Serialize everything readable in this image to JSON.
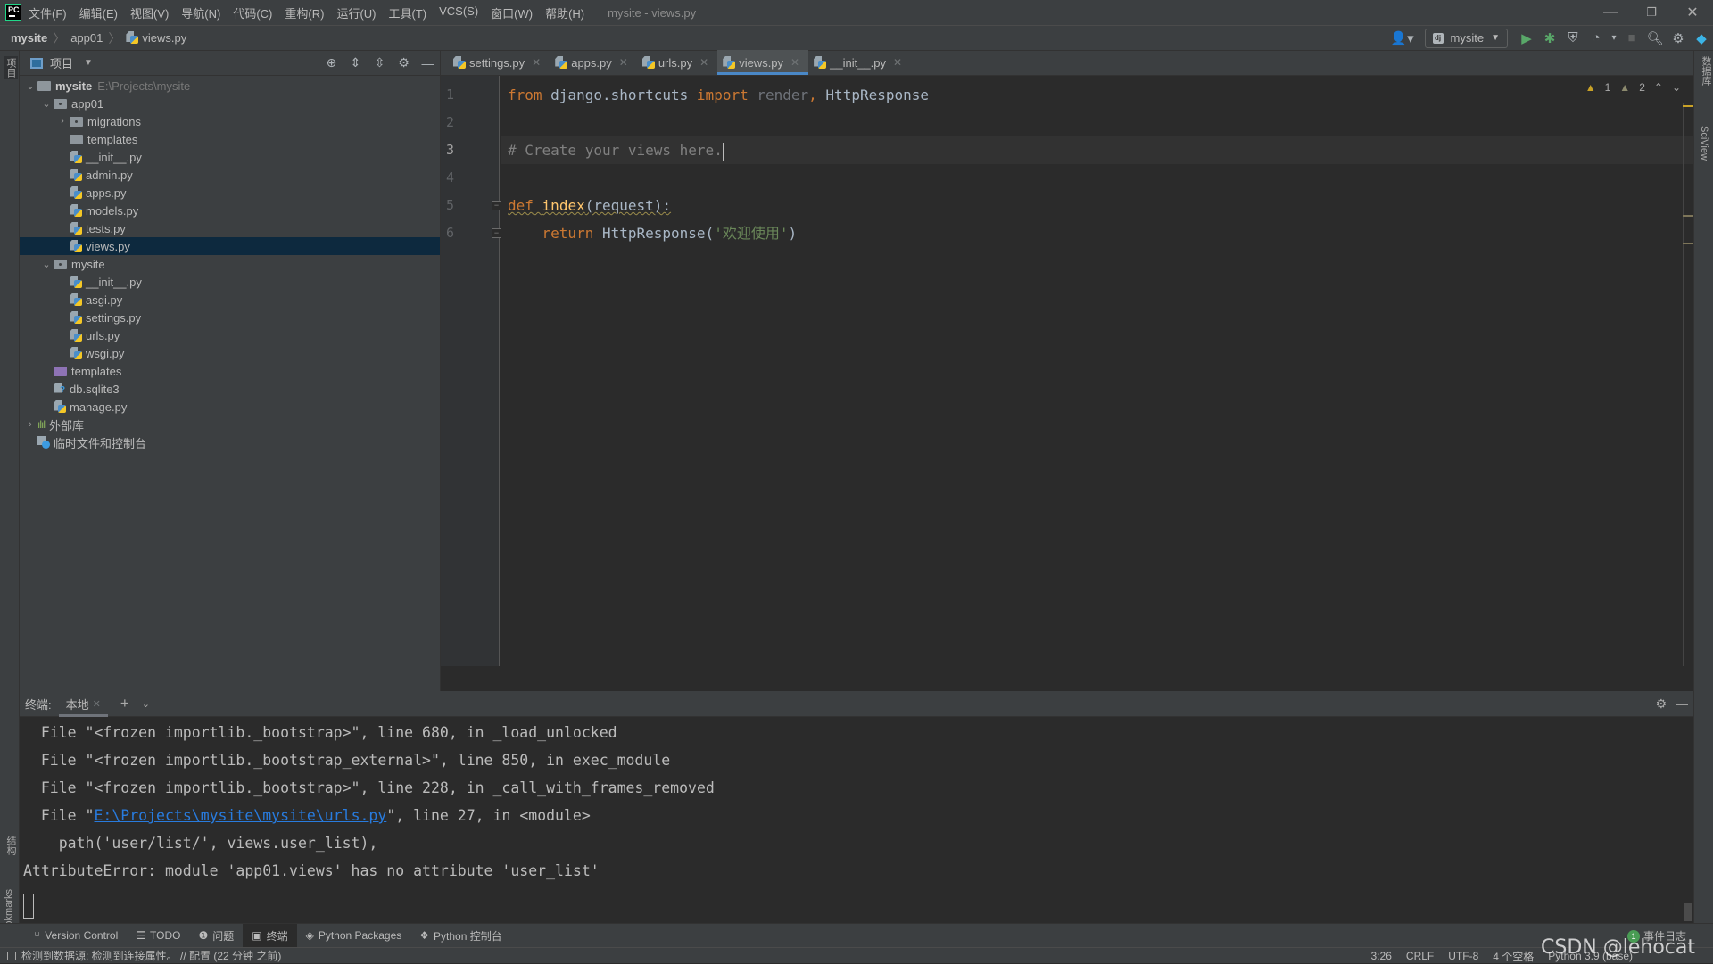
{
  "window": {
    "title": "mysite - views.py",
    "logo": "PC",
    "menu": [
      "文件(F)",
      "编辑(E)",
      "视图(V)",
      "导航(N)",
      "代码(C)",
      "重构(R)",
      "运行(U)",
      "工具(T)",
      "VCS(S)",
      "窗口(W)",
      "帮助(H)"
    ],
    "controls": {
      "minimize": "—",
      "restore": "❐",
      "close": "✕"
    }
  },
  "navbar": {
    "breadcrumb": [
      "mysite",
      "app01",
      "views.py"
    ],
    "run_config": "mysite",
    "run_config_icon": "dj"
  },
  "left_stripe": {
    "project_label": "项目",
    "structure_label": "结构",
    "bookmarks_label": "Bookmarks"
  },
  "right_stripe": {
    "database_label": "数据库",
    "sciview_label": "SciView"
  },
  "project_panel": {
    "title": "项目",
    "tree": [
      {
        "label": "mysite",
        "hint": "E:\\Projects\\mysite",
        "level": 0,
        "type": "folder",
        "expanded": true,
        "bold": true
      },
      {
        "label": "app01",
        "level": 1,
        "type": "module",
        "expanded": true
      },
      {
        "label": "migrations",
        "level": 2,
        "type": "module",
        "expanded": false
      },
      {
        "label": "templates",
        "level": 2,
        "type": "folder"
      },
      {
        "label": "__init__.py",
        "level": 2,
        "type": "py"
      },
      {
        "label": "admin.py",
        "level": 2,
        "type": "py"
      },
      {
        "label": "apps.py",
        "level": 2,
        "type": "py"
      },
      {
        "label": "models.py",
        "level": 2,
        "type": "py"
      },
      {
        "label": "tests.py",
        "level": 2,
        "type": "py"
      },
      {
        "label": "views.py",
        "level": 2,
        "type": "py",
        "selected": true
      },
      {
        "label": "mysite",
        "level": 1,
        "type": "module",
        "expanded": true
      },
      {
        "label": "__init__.py",
        "level": 2,
        "type": "py"
      },
      {
        "label": "asgi.py",
        "level": 2,
        "type": "py"
      },
      {
        "label": "settings.py",
        "level": 2,
        "type": "py"
      },
      {
        "label": "urls.py",
        "level": 2,
        "type": "py"
      },
      {
        "label": "wsgi.py",
        "level": 2,
        "type": "py"
      },
      {
        "label": "templates",
        "level": 1,
        "type": "purple"
      },
      {
        "label": "db.sqlite3",
        "level": 1,
        "type": "db"
      },
      {
        "label": "manage.py",
        "level": 1,
        "type": "py"
      },
      {
        "label": "外部库",
        "level": 0,
        "type": "lib",
        "expanded": false
      },
      {
        "label": "临时文件和控制台",
        "level": 0,
        "type": "scratch"
      }
    ]
  },
  "editor": {
    "tabs": [
      {
        "label": "settings.py",
        "active": false
      },
      {
        "label": "apps.py",
        "active": false
      },
      {
        "label": "urls.py",
        "active": false
      },
      {
        "label": "views.py",
        "active": true
      },
      {
        "label": "__init__.py",
        "active": false
      }
    ],
    "inspections": {
      "warnings": "1",
      "weak_warnings": "2"
    },
    "current_line": 3,
    "lines": [
      {
        "num": "1",
        "tokens": [
          {
            "t": "from",
            "c": "kw"
          },
          {
            "t": " django.shortcuts ",
            "c": ""
          },
          {
            "t": "import",
            "c": "kw"
          },
          {
            "t": " render",
            "c": "unused"
          },
          {
            "t": ", ",
            "c": "kw"
          },
          {
            "t": "HttpResponse",
            "c": ""
          }
        ]
      },
      {
        "num": "2",
        "tokens": []
      },
      {
        "num": "3",
        "tokens": [
          {
            "t": "# Create your views here.",
            "c": "cmt"
          }
        ]
      },
      {
        "num": "4",
        "tokens": []
      },
      {
        "num": "5",
        "tokens": [
          {
            "t": "def",
            "c": "kw wavy"
          },
          {
            "t": " ",
            "c": "wavy"
          },
          {
            "t": "index",
            "c": "fn wavy"
          },
          {
            "t": "(request):",
            "c": "wavy"
          }
        ]
      },
      {
        "num": "6",
        "tokens": [
          {
            "t": "    ",
            "c": ""
          },
          {
            "t": "return",
            "c": "kw"
          },
          {
            "t": " HttpResponse(",
            "c": ""
          },
          {
            "t": "'欢迎使用'",
            "c": "str"
          },
          {
            "t": ")",
            "c": ""
          }
        ]
      }
    ]
  },
  "terminal": {
    "label": "终端:",
    "tab": "本地",
    "lines": [
      {
        "text": "  File \"<frozen importlib._bootstrap>\", line 680, in _load_unlocked"
      },
      {
        "text": "  File \"<frozen importlib._bootstrap_external>\", line 850, in exec_module"
      },
      {
        "text": "  File \"<frozen importlib._bootstrap>\", line 228, in _call_with_frames_removed"
      },
      {
        "pre": "  File \"",
        "link": "E:\\Projects\\mysite\\mysite\\urls.py",
        "post": "\", line 27, in <module>"
      },
      {
        "text": "    path('user/list/', views.user_list),"
      },
      {
        "text": "AttributeError: module 'app01.views' has no attribute 'user_list'"
      }
    ]
  },
  "tool_windows": [
    {
      "label": "Version Control",
      "icon": "⑂",
      "active": false
    },
    {
      "label": "TODO",
      "icon": "☰",
      "active": false
    },
    {
      "label": "问题",
      "icon": "❶",
      "active": false
    },
    {
      "label": "终端",
      "icon": "▣",
      "active": true
    },
    {
      "label": "Python Packages",
      "icon": "◈",
      "active": false
    },
    {
      "label": "Python 控制台",
      "icon": "❖",
      "active": false
    }
  ],
  "event_log": {
    "count": "1",
    "label": "事件日志"
  },
  "status": {
    "message": "检测到数据源: 检测到连接属性。 // 配置 (22 分钟 之前)",
    "position": "3:26",
    "line_ending": "CRLF",
    "encoding": "UTF-8",
    "indent": "4 个空格",
    "interpreter": "Python 3.9 (base)"
  },
  "watermark": "CSDN @lehocat"
}
